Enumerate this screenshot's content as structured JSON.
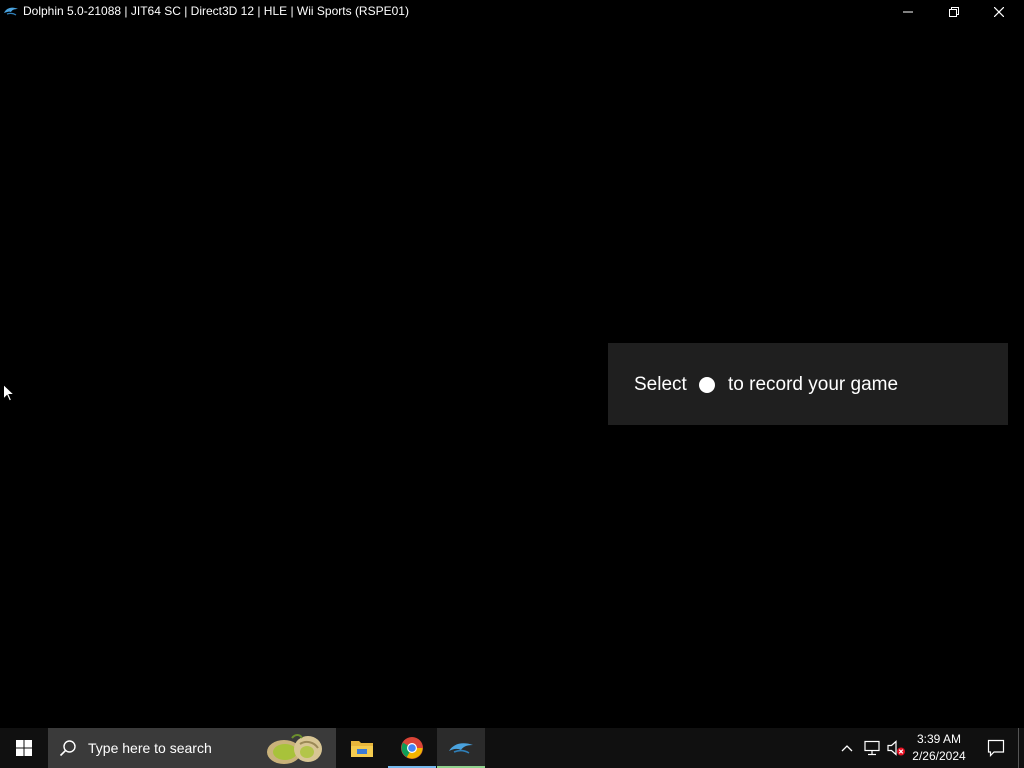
{
  "window": {
    "title": "Dolphin 5.0-21088 | JIT64 SC | Direct3D 12 | HLE | Wii Sports (RSPE01)",
    "icon": "dolphin-icon",
    "controls": {
      "minimize_icon": "minimize-icon",
      "restore_icon": "restore-icon",
      "close_icon": "close-icon"
    }
  },
  "game_bar_toast": {
    "text_before": "Select",
    "button_icon": "record-dot-icon",
    "text_after": "to record your game"
  },
  "taskbar": {
    "start_icon": "windows-logo-icon",
    "search": {
      "placeholder": "Type here to search",
      "icon": "search-icon"
    },
    "pinned_apps": [
      {
        "name": "File Explorer",
        "icon": "folder-icon",
        "running": false
      },
      {
        "name": "Google Chrome",
        "icon": "chrome-icon",
        "running": true
      },
      {
        "name": "Dolphin",
        "icon": "dolphin-icon",
        "running": true,
        "active": true
      }
    ],
    "tray": {
      "chevron_icon": "chevron-up-icon",
      "network_icon": "network-icon",
      "volume_icon": "volume-muted-icon"
    },
    "clock": {
      "time": "3:39 AM",
      "date": "2/26/2024"
    },
    "notification_icon": "notification-icon"
  },
  "colors": {
    "background": "#000000",
    "toast_background": "#1f1f1f",
    "taskbar": "#101010",
    "search_box": "#3a3a3a",
    "accent_underline": "#76b9ed"
  }
}
